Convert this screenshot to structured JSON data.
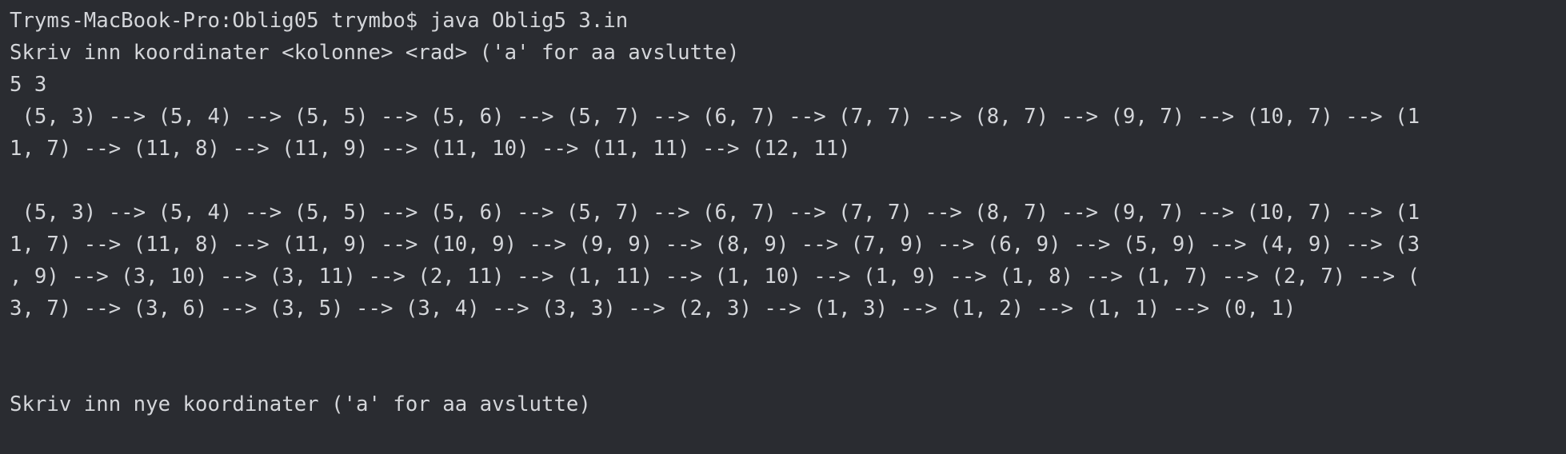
{
  "terminal": {
    "lines": [
      "Tryms-MacBook-Pro:Oblig05 trymbo$ java Oblig5 3.in",
      "Skriv inn koordinater <kolonne> <rad> ('a' for aa avslutte)",
      "5 3",
      " (5, 3) --> (5, 4) --> (5, 5) --> (5, 6) --> (5, 7) --> (6, 7) --> (7, 7) --> (8, 7) --> (9, 7) --> (10, 7) --> (1",
      "1, 7) --> (11, 8) --> (11, 9) --> (11, 10) --> (11, 11) --> (12, 11)",
      "",
      " (5, 3) --> (5, 4) --> (5, 5) --> (5, 6) --> (5, 7) --> (6, 7) --> (7, 7) --> (8, 7) --> (9, 7) --> (10, 7) --> (1",
      "1, 7) --> (11, 8) --> (11, 9) --> (10, 9) --> (9, 9) --> (8, 9) --> (7, 9) --> (6, 9) --> (5, 9) --> (4, 9) --> (3",
      ", 9) --> (3, 10) --> (3, 11) --> (2, 11) --> (1, 11) --> (1, 10) --> (1, 9) --> (1, 8) --> (1, 7) --> (2, 7) --> (",
      "3, 7) --> (3, 6) --> (3, 5) --> (3, 4) --> (3, 3) --> (2, 3) --> (1, 3) --> (1, 2) --> (1, 1) --> (0, 1)",
      "",
      "",
      "Skriv inn nye koordinater ('a' for aa avslutte)"
    ]
  },
  "colors": {
    "background": "#2a2c31",
    "text": "#d4d6da"
  }
}
